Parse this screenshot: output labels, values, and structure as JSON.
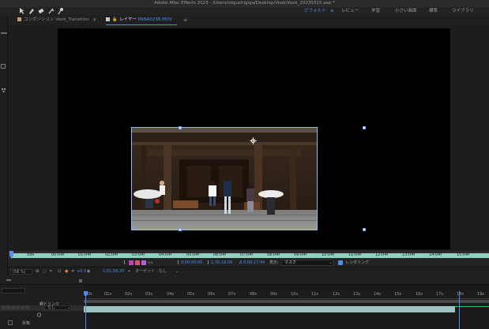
{
  "window": {
    "title": "Adobe After Effects 2023 - /Users/noguchigiga/Desktop/Vook/Vook_20230315.aep *"
  },
  "toolbar": {
    "tools": [
      "select-tool",
      "hand-tool",
      "zoom-tool",
      "rotate-tool",
      "pen-tool",
      "brush-tool",
      "pin-tool"
    ],
    "workspaces": [
      {
        "label": "デフォルト",
        "active": true
      },
      {
        "label": "レビュー",
        "active": false
      },
      {
        "label": "学習",
        "active": false
      },
      {
        "label": "小さい画面",
        "active": false
      },
      {
        "label": "標準",
        "active": false
      },
      {
        "label": "ライブラリ",
        "active": false
      }
    ],
    "workspace_menu": "≡"
  },
  "panel_tabs": {
    "composition": "コンポジション Vook_Transition",
    "layer_prefix": "レイヤー",
    "layer_file": "PANA0238.MOV",
    "menu": "≡"
  },
  "layer_ruler": {
    "labels": [
      "59s",
      "00:04f",
      "01:04f",
      "02:04f",
      "03:04f",
      "04:04f",
      "05:04f",
      "06:04f",
      "07:04f",
      "08:04f",
      "09:04f",
      "10:04f",
      "11:04f",
      "12:04f",
      "13:04f",
      "14:04f",
      "15:04f"
    ]
  },
  "layer_controls": {
    "in_time": "0;00;00;00",
    "out_time": "1;36;16;06",
    "duration": "Δ 0;00;17;44",
    "view_label": "表示:",
    "view_value": "マスク",
    "render_label": "レンダリング",
    "render_checked": true
  },
  "viewer_footer": {
    "zoom": "(58 %)",
    "color_value": "+0.0",
    "timecode": "1;01;58;20",
    "target_label": "ターゲット : なし"
  },
  "timeline": {
    "ticks": [
      "0s",
      "01s",
      "02s",
      "03s",
      "04s",
      "05s",
      "06s",
      "07s",
      "08s",
      "09s",
      "10s",
      "11s",
      "12s",
      "13s",
      "14s",
      "15s",
      "16s",
      "17s",
      "18s",
      "19s"
    ],
    "parent_header": "親とリンク",
    "parent_value": "なし",
    "toggle_label": "反転"
  },
  "colors": {
    "accent": "#4a8cf0",
    "layer_bar": "#9fc3bf",
    "ruler_bar": "#8fd0c0",
    "comp_tab_square": "#b8a070",
    "layer_tab_square": "#c8c8c8"
  }
}
